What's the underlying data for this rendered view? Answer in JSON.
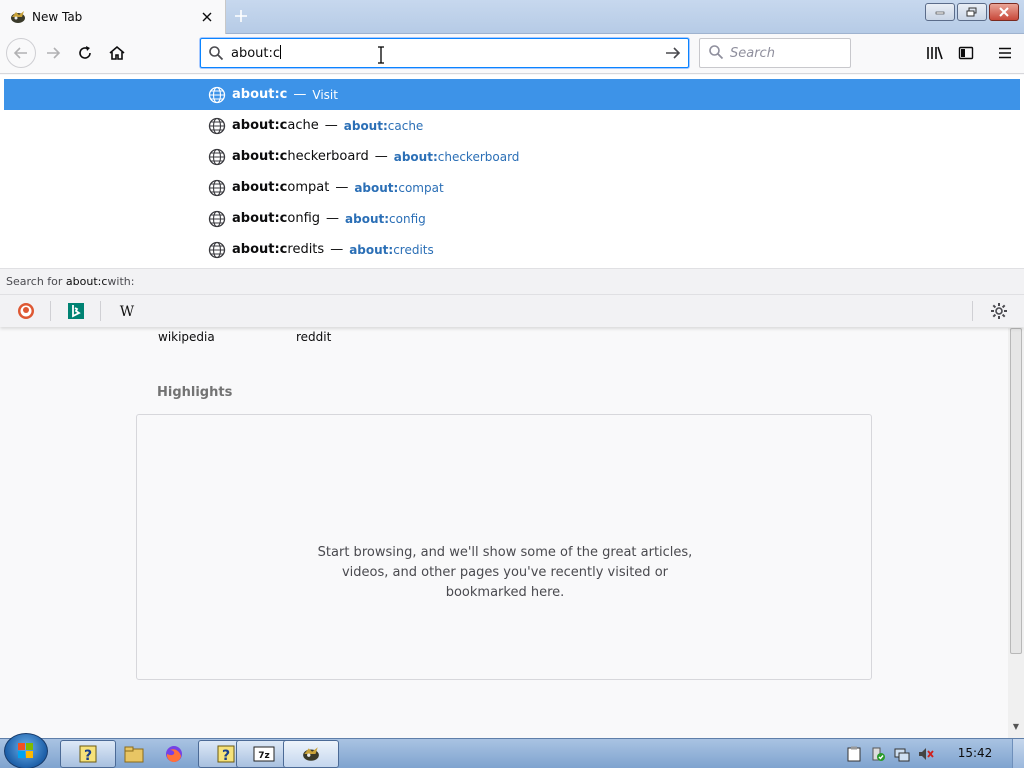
{
  "tab": {
    "title": "New Tab",
    "favicon": "firefox-nightly-icon"
  },
  "window_controls": [
    "minimize",
    "maximize",
    "close"
  ],
  "urlbar": {
    "value": "about:c",
    "go_icon": "arrow-right-icon"
  },
  "searchbar": {
    "placeholder": "Search"
  },
  "autocomplete": [
    {
      "prefix": "about:c",
      "rest": "",
      "action": "Visit",
      "url_prefix": "",
      "url_rest": "",
      "selected": true
    },
    {
      "prefix": "about:c",
      "rest": "ache",
      "action": "",
      "url_prefix": "about:",
      "url_rest": "cache",
      "selected": false
    },
    {
      "prefix": "about:c",
      "rest": "heckerboard",
      "action": "",
      "url_prefix": "about:",
      "url_rest": "checkerboard",
      "selected": false
    },
    {
      "prefix": "about:c",
      "rest": "ompat",
      "action": "",
      "url_prefix": "about:",
      "url_rest": "compat",
      "selected": false
    },
    {
      "prefix": "about:c",
      "rest": "onfig",
      "action": "",
      "url_prefix": "about:",
      "url_rest": "config",
      "selected": false
    },
    {
      "prefix": "about:c",
      "rest": "redits",
      "action": "",
      "url_prefix": "about:",
      "url_rest": "credits",
      "selected": false
    }
  ],
  "search_for": {
    "prefix": "Search for ",
    "query": "about:c",
    "suffix": " with:"
  },
  "search_engines": [
    "duckduckgo-icon",
    "bing-icon",
    "wikipedia-icon"
  ],
  "content": {
    "top_sites": [
      "wikipedia",
      "reddit"
    ],
    "highlights_title": "Highlights",
    "highlights_msg_line1": "Start browsing, and we'll show some of the great articles,",
    "highlights_msg_line2": "videos, and other pages you've recently visited or",
    "highlights_msg_line3": "bookmarked here."
  },
  "taskbar": {
    "items": [
      "help-icon",
      "file-explorer-icon",
      "firefox-icon",
      "help-icon",
      "7zip-icon",
      "firefox-nightly-icon"
    ],
    "clock": "15:42"
  },
  "colors": {
    "accent": "#0a84ff",
    "selection": "#3d93e8",
    "url_link": "#2b6fb6"
  }
}
